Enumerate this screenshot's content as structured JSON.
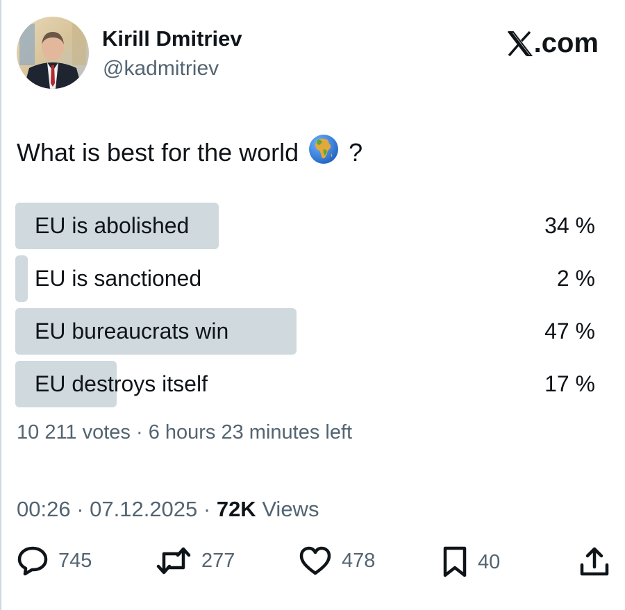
{
  "author": {
    "name": "Kirill Dmitriev",
    "handle": "@kadmitriev"
  },
  "brand": {
    "suffix": ".com"
  },
  "tweet": {
    "question_before": "What is best for the world",
    "question_emoji": "globe-africa",
    "question_after": "?"
  },
  "poll": {
    "options": [
      {
        "label": "EU is abolished",
        "percent_text": "34 %",
        "share": 0.34
      },
      {
        "label": "EU is sanctioned",
        "percent_text": "2 %",
        "share": 0.02
      },
      {
        "label": "EU bureaucrats win",
        "percent_text": "47 %",
        "share": 0.47
      },
      {
        "label": "EU destroys itself",
        "percent_text": "17 %",
        "share": 0.17
      }
    ],
    "meta": "10 211 votes · 6 hours 23 minutes left"
  },
  "timestamp": {
    "time_date": "00:26 · 07.12.2025 · ",
    "views_count": "72K",
    "views_label": " Views"
  },
  "actions": {
    "replies": "745",
    "reposts": "277",
    "likes": "478",
    "bookmarks": "40"
  },
  "colors": {
    "text_primary": "#0f1419",
    "text_secondary": "#536471",
    "poll_fill": "#cfd9de"
  }
}
